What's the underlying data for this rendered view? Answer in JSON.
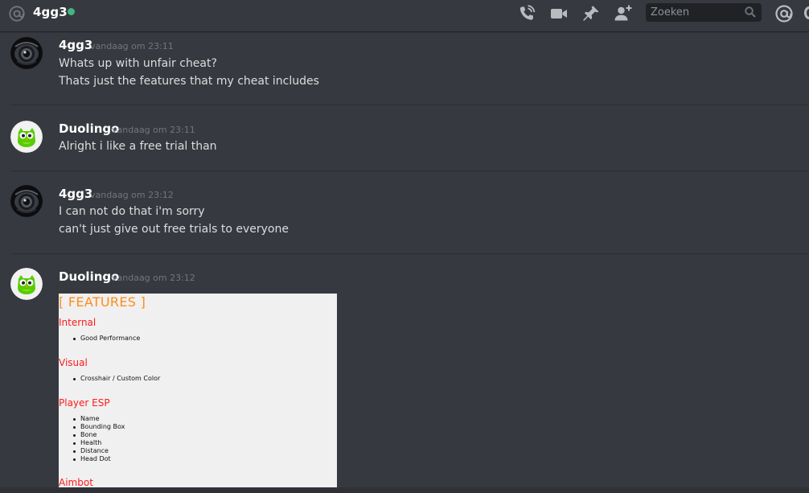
{
  "header": {
    "channel_name": "4gg3",
    "search_placeholder": "Zoeken",
    "status_color": "#43b581",
    "icons": [
      "at-sign-icon",
      "phone-call-icon",
      "video-camera-icon",
      "pin-icon",
      "add-friend-icon",
      "search-icon",
      "mentions-icon"
    ]
  },
  "messages": [
    {
      "author": "4gg3",
      "timestamp": "vandaag om 23:11",
      "avatar": "eye-camera-avatar",
      "lines": [
        "Whats up with unfair cheat?",
        "Thats just the features that my cheat includes"
      ]
    },
    {
      "author": "Duolingo",
      "timestamp": "vandaag om 23:11",
      "avatar": "green-owl-avatar",
      "lines": [
        "Alright i like a free trial than"
      ]
    },
    {
      "author": "4gg3",
      "timestamp": "vandaag om 23:12",
      "avatar": "eye-camera-avatar",
      "lines": [
        "I can not do that i'm sorry",
        "can't just give out free trials to everyone"
      ]
    },
    {
      "author": "Duolingo",
      "timestamp": "vandaag om 23:12",
      "avatar": "green-owl-avatar",
      "lines": []
    }
  ],
  "attachment": {
    "title": "[ FEATURES ]",
    "sections": [
      {
        "heading": "Internal",
        "items": [
          "Good Performance"
        ]
      },
      {
        "heading": "Visual",
        "items": [
          "Crosshair / Custom Color"
        ]
      },
      {
        "heading": "Player ESP",
        "items": [
          "Name",
          "Bounding Box",
          "Bone",
          "Health",
          "Distance",
          "Head Dot"
        ]
      },
      {
        "heading": "Aimbot",
        "items": []
      }
    ],
    "colors": {
      "title": "#ff8c1a",
      "heading": "#ff1a1a",
      "background": "#f0f0f0"
    }
  }
}
